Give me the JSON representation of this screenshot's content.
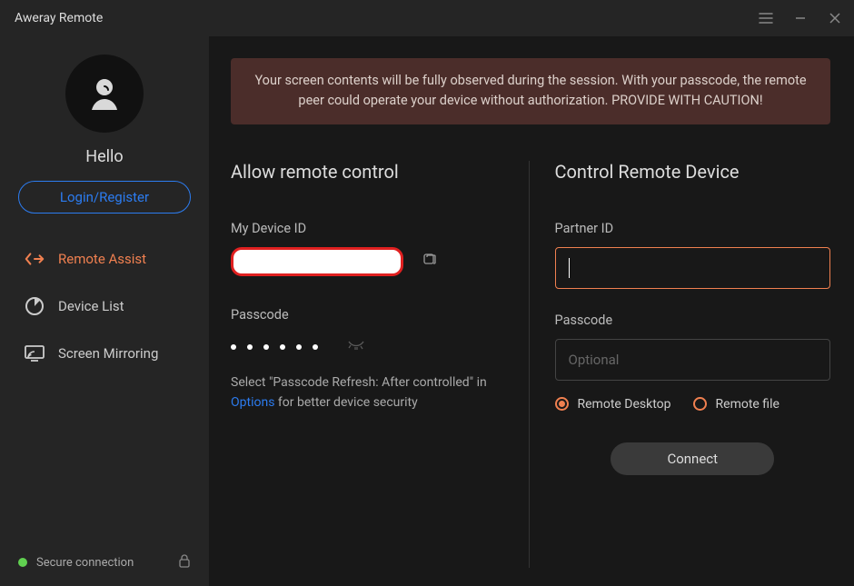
{
  "titlebar": {
    "app_name": "Aweray Remote"
  },
  "sidebar": {
    "greeting": "Hello",
    "login_button": "Login/Register",
    "items": [
      {
        "label": "Remote Assist"
      },
      {
        "label": "Device List"
      },
      {
        "label": "Screen Mirroring"
      }
    ],
    "status_text": "Secure connection"
  },
  "main": {
    "warning": "Your screen contents will be fully observed during the session. With your passcode, the remote peer could operate your device without authorization. PROVIDE WITH CAUTION!",
    "left": {
      "title": "Allow remote control",
      "device_id_label": "My Device ID",
      "passcode_label": "Passcode",
      "hint_pre": "Select \"Passcode Refresh: After controlled\" in ",
      "hint_link": "Options",
      "hint_post": " for better device security"
    },
    "right": {
      "title": "Control Remote Device",
      "partner_id_label": "Partner ID",
      "passcode_label": "Passcode",
      "passcode_placeholder": "Optional",
      "radio_desktop": "Remote Desktop",
      "radio_file": "Remote file",
      "connect": "Connect"
    }
  }
}
